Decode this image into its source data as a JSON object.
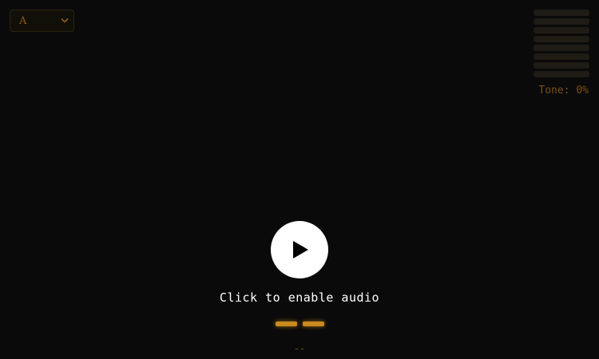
{
  "note_select": {
    "value": "A",
    "options": [
      "A"
    ]
  },
  "tone": {
    "readout": "Tone: 0%",
    "level_percent": 0,
    "bar_count": 8
  },
  "overlay": {
    "enable_label": "Click to enable audio",
    "play_icon": "play-icon"
  },
  "status": {
    "readout": "--"
  },
  "colors": {
    "background": "#0a0a0a",
    "accent": "#c98a1e",
    "muted_accent": "#7a5218"
  }
}
